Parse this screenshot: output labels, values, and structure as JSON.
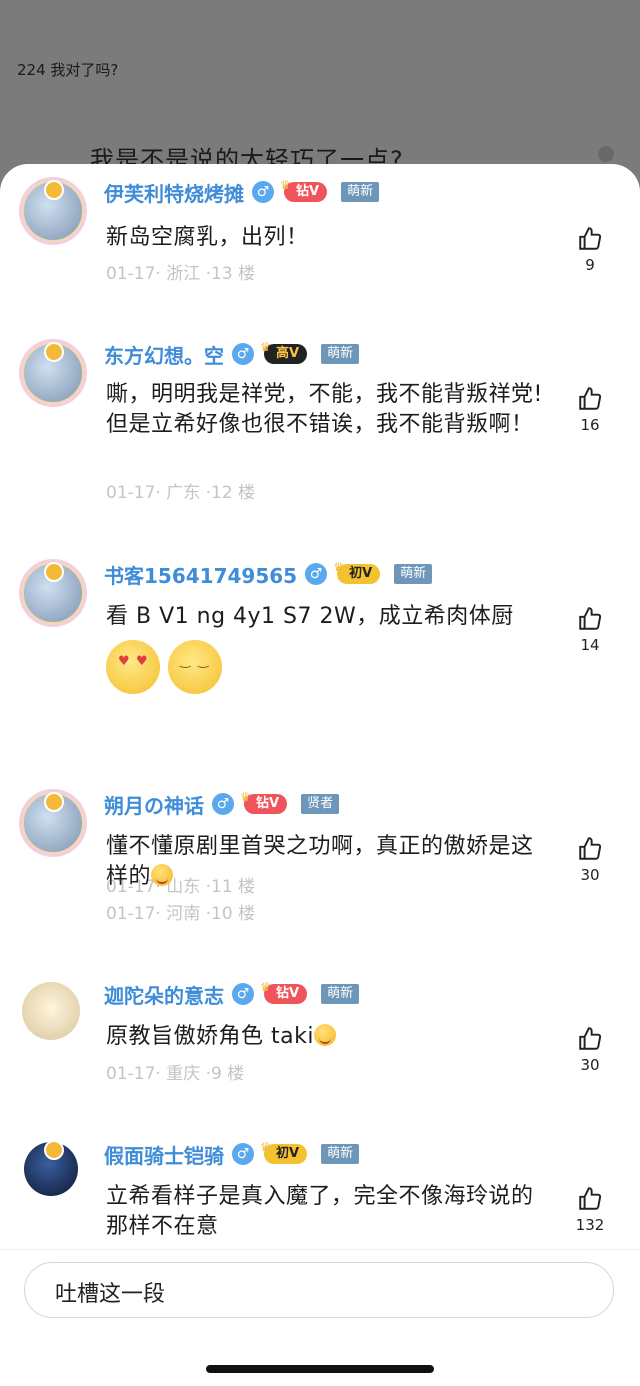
{
  "background": {
    "header": "224 我对了吗?",
    "line": "我是不是说的太轻巧了一点?"
  },
  "comments": [
    {
      "name": "伊芙利特烧烤摊",
      "gender": "♂",
      "level": "钻V",
      "tag": "萌新",
      "text": "新岛空腐乳，出列！",
      "meta": "01-17· 浙江 ·13 楼",
      "likes": "9"
    },
    {
      "name": "东方幻想。空",
      "gender": "♂",
      "level": "高V",
      "tag": "萌新",
      "text": "嘶，明明我是祥党，不能，我不能背叛祥党!但是立希好像也很不错诶，我不能背叛啊！",
      "meta": "01-17· 广东 ·12 楼",
      "likes": "16"
    },
    {
      "name": "书客15641749565",
      "gender": "♂",
      "level": "初V",
      "tag": "萌新",
      "text": "看 B V1 ng 4y1 S7 2W，成立希肉体厨",
      "meta": "01-17· 山东 ·11 楼",
      "likes": "14"
    },
    {
      "name": "朔月の神话",
      "gender": "♂",
      "level": "钻V",
      "tag": "贤者",
      "text": "懂不懂原剧里首哭之功啊，真正的傲娇是这样的",
      "meta": "01-17· 河南 ·10 楼",
      "likes": "30"
    },
    {
      "name": "迦陀朵的意志",
      "gender": "♂",
      "level": "钻V",
      "tag": "萌新",
      "text": "原教旨傲娇角色 taki",
      "meta": "01-17· 重庆 ·9 楼",
      "likes": "30"
    },
    {
      "name": "假面骑士铠骑",
      "gender": "♂",
      "level": "初V",
      "tag": "萌新",
      "text": "立希看样子是真入魔了，完全不像海玲说的那样不在意",
      "meta": "",
      "likes": "132"
    }
  ],
  "input": {
    "placeholder": "吐槽这一段"
  },
  "colors": {
    "name": "#3f8cd8",
    "gender": "#5aa8ee",
    "tag": "#6d96b8",
    "level_red": "#f0545b",
    "level_yellow": "#f5c22f"
  }
}
